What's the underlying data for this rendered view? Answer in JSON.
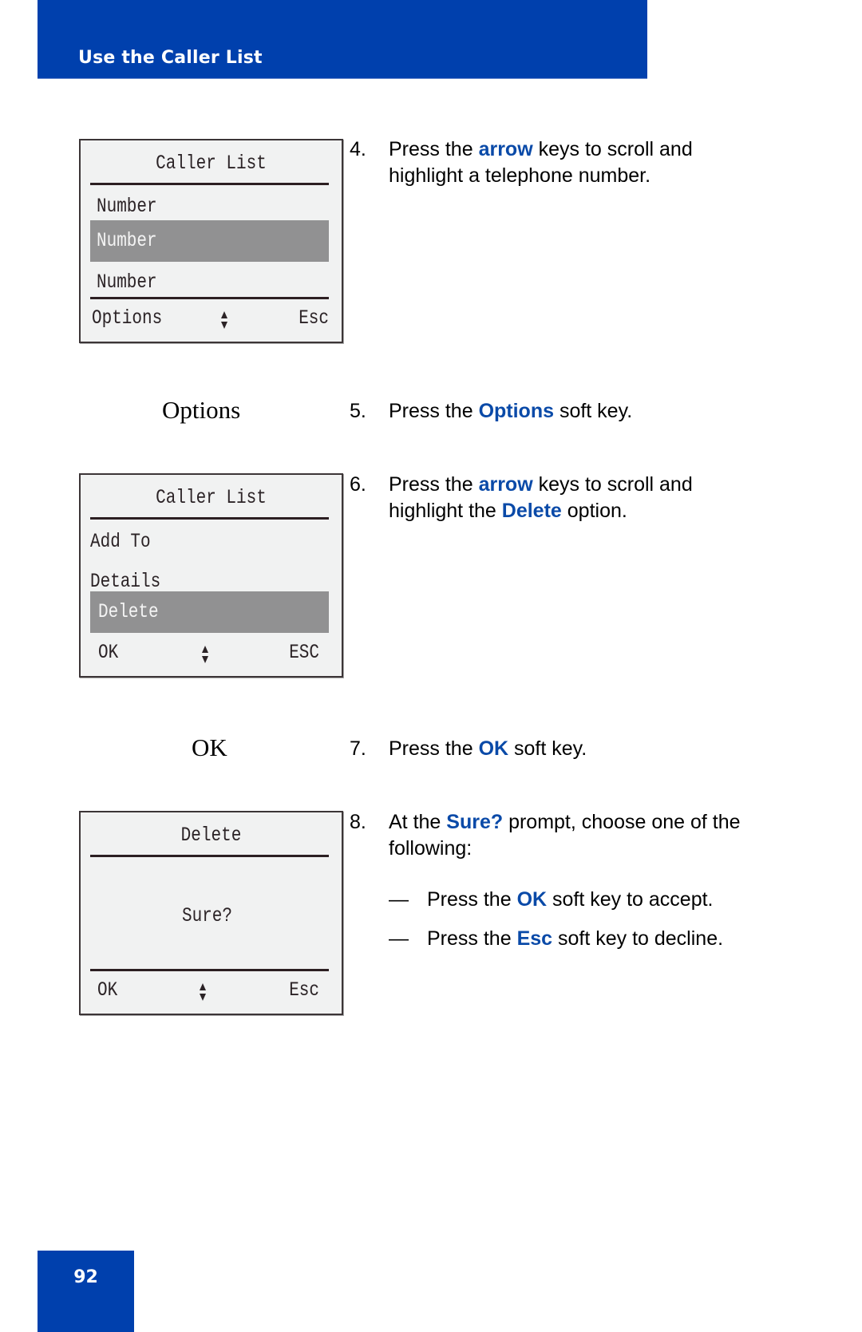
{
  "header": {
    "title": "Use the Caller List",
    "accent_color": "#0040ad"
  },
  "footer": {
    "page_number": "92"
  },
  "screens": [
    {
      "title": "Caller List",
      "rows": [
        {
          "label": "Number",
          "selected": false
        },
        {
          "label": "Number",
          "selected": true
        },
        {
          "label": "Number",
          "selected": false
        }
      ],
      "softkeys": {
        "left": "Options",
        "nav_icon": "up-down-arrow",
        "right": "Esc"
      }
    },
    {
      "title": "Caller List",
      "rows": [
        {
          "label": "Add To",
          "selected": false
        },
        {
          "label": "Details",
          "selected": false
        },
        {
          "label": "Delete",
          "selected": true
        }
      ],
      "softkeys": {
        "left": "OK",
        "nav_icon": "up-down-arrow",
        "right": "ESC"
      }
    },
    {
      "title": "Delete",
      "message": "Sure?",
      "softkeys": {
        "left": "OK",
        "nav_icon": "up-down-arrow",
        "right": "Esc"
      }
    }
  ],
  "key_labels": {
    "options": "Options",
    "ok": "OK"
  },
  "steps": [
    {
      "num": "4.",
      "parts": [
        "Press the ",
        "arrow",
        " keys to scroll and highlight a telephone number."
      ]
    },
    {
      "num": "5.",
      "parts": [
        "Press the ",
        "Options",
        " soft key."
      ]
    },
    {
      "num": "6.",
      "parts": [
        "Press the ",
        "arrow",
        " keys to scroll and highlight the ",
        "Delete",
        " option."
      ]
    },
    {
      "num": "7.",
      "parts": [
        "Press the ",
        "OK",
        " soft key."
      ]
    },
    {
      "num": "8.",
      "parts": [
        "At the ",
        "Sure?",
        " prompt, choose one of the following:"
      ]
    }
  ],
  "bullets": [
    {
      "dash": "—",
      "parts": [
        "Press the ",
        "OK",
        " soft key to accept."
      ]
    },
    {
      "dash": "—",
      "parts": [
        "Press the ",
        "Esc",
        " soft key to decline."
      ]
    }
  ]
}
